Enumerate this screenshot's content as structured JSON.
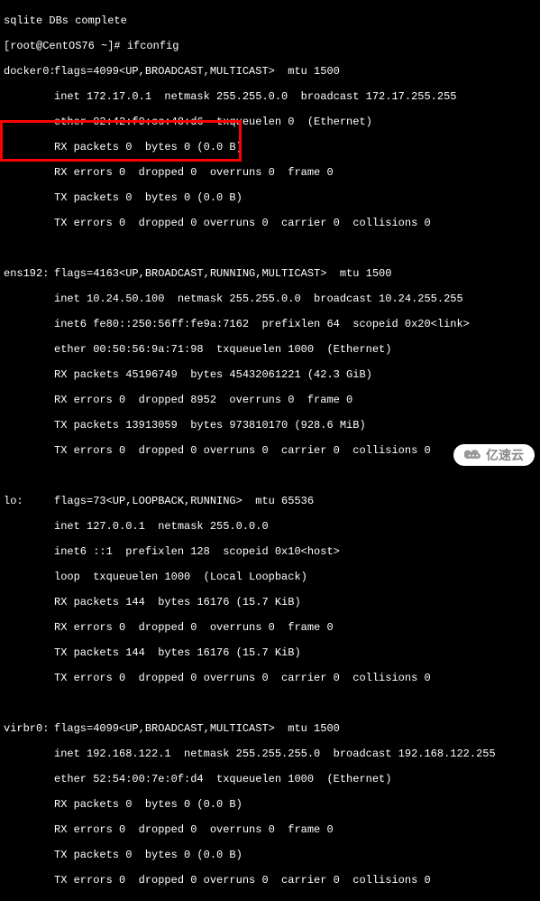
{
  "header": {
    "prev_line": "sqlite DBs complete",
    "prompt": "[root@CentOS76 ~]# ",
    "command": "ifconfig"
  },
  "interfaces": {
    "docker0": {
      "name": "docker0:",
      "flags": "flags=4099<UP,BROADCAST,MULTICAST>  mtu 1500",
      "inet": "inet 172.17.0.1  netmask 255.255.0.0  broadcast 172.17.255.255",
      "ether": "ether 02:42:f9:cc:48:d6  txqueuelen 0  (Ethernet)",
      "rx_packets": "RX packets 0  bytes 0 (0.0 B)",
      "rx_errors": "RX errors 0  dropped 0  overruns 0  frame 0",
      "tx_packets": "TX packets 0  bytes 0 (0.0 B)",
      "tx_errors": "TX errors 0  dropped 0 overruns 0  carrier 0  collisions 0"
    },
    "ens192": {
      "name": "ens192:",
      "flags": "flags=4163<UP,BROADCAST,RUNNING,MULTICAST>  mtu 1500",
      "inet": "inet 10.24.50.100  netmask 255.255.0.0  broadcast 10.24.255.255",
      "inet6": "inet6 fe80::250:56ff:fe9a:7162  prefixlen 64  scopeid 0x20<link>",
      "ether": "ether 00:50:56:9a:71:98  txqueuelen 1000  (Ethernet)",
      "rx_packets": "RX packets 45196749  bytes 45432061221 (42.3 GiB)",
      "rx_errors": "RX errors 0  dropped 8952  overruns 0  frame 0",
      "tx_packets": "TX packets 13913059  bytes 973810170 (928.6 MiB)",
      "tx_errors": "TX errors 0  dropped 0 overruns 0  carrier 0  collisions 0"
    },
    "lo": {
      "name": "lo:",
      "flags": "flags=73<UP,LOOPBACK,RUNNING>  mtu 65536",
      "inet": "inet 127.0.0.1  netmask 255.0.0.0",
      "inet6": "inet6 ::1  prefixlen 128  scopeid 0x10<host>",
      "loop": "loop  txqueuelen 1000  (Local Loopback)",
      "rx_packets": "RX packets 144  bytes 16176 (15.7 KiB)",
      "rx_errors": "RX errors 0  dropped 0  overruns 0  frame 0",
      "tx_packets": "TX packets 144  bytes 16176 (15.7 KiB)",
      "tx_errors": "TX errors 0  dropped 0 overruns 0  carrier 0  collisions 0"
    },
    "virbr0": {
      "name": "virbr0:",
      "flags": "flags=4099<UP,BROADCAST,MULTICAST>  mtu 1500",
      "inet": "inet 192.168.122.1  netmask 255.255.255.0  broadcast 192.168.122.255",
      "ether": "ether 52:54:00:7e:0f:d4  txqueuelen 1000  (Ethernet)",
      "rx_packets": "RX packets 0  bytes 0 (0.0 B)",
      "rx_errors": "RX errors 0  dropped 0  overruns 0  frame 0",
      "tx_packets": "TX packets 0  bytes 0 (0.0 B)",
      "tx_errors": "TX errors 0  dropped 0 overruns 0  carrier 0  collisions 0"
    }
  },
  "watermark": {
    "text": "亿速云"
  }
}
